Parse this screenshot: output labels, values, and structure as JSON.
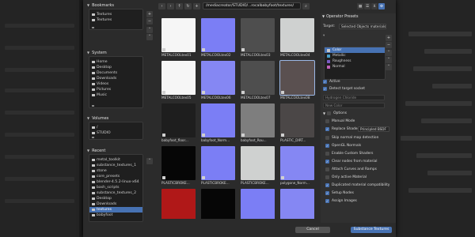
{
  "sidebar": {
    "bookmarks": {
      "title": "Bookmarks",
      "items": [
        "Textures",
        "Textures"
      ]
    },
    "system": {
      "title": "System",
      "items": [
        "Home",
        "Desktop",
        "Documents",
        "Downloads",
        "Videos",
        "Pictures",
        "Music"
      ]
    },
    "volumes": {
      "title": "Volumes",
      "items": [
        "/",
        "STUDIO"
      ]
    },
    "recent": {
      "title": "Recent",
      "items": [
        "metal_toolkit",
        "substance_textures_1",
        "stone",
        "core_presets",
        "blender-4.5.2-linux-x64",
        "bash_scripts",
        "substance_textures_2",
        "Desktop",
        "Downloads",
        "textures",
        "babyfoot"
      ]
    }
  },
  "topbar": {
    "path": "/mediacreator/STUDIO/...rocalbabyfoot/textures/"
  },
  "grid": {
    "tiles": [
      {
        "label": "METALCOOLtex01"
      },
      {
        "label": "METALCOOLtex02"
      },
      {
        "label": "METALCOOLtex03"
      },
      {
        "label": "METALCOOLtex04"
      },
      {
        "label": "METALCOOLtex05"
      },
      {
        "label": "METALCOOLtex06"
      },
      {
        "label": "METALCOOLtex07"
      },
      {
        "label": "METALCOOLtex08"
      },
      {
        "label": "babyfoot_floor..."
      },
      {
        "label": "babyfoot_Norm..."
      },
      {
        "label": "babyfoot_Rou..."
      },
      {
        "label": "PLASTIC_DIRT..."
      },
      {
        "label": "PLASTICBROKE..."
      },
      {
        "label": "PLASTICBROKE..."
      },
      {
        "label": "PLASTICBROKE..."
      },
      {
        "label": "polygone_Norm..."
      },
      {
        "label": "PLASTICBROKE..."
      },
      {
        "label": "PLASTICBROKE..."
      },
      {
        "label": "PLASTICBROKE..."
      },
      {
        "label": "PLASTICBROKE..."
      }
    ]
  },
  "operator": {
    "presets_label": "Operator Presets",
    "target_label": "Target:",
    "target_value": "Selected Objects materials",
    "layers": [
      {
        "name": "Color",
        "color": "#c9c9c9"
      },
      {
        "name": "Metallic",
        "color": "#49a0c9"
      },
      {
        "name": "Roughness",
        "color": "#7a5cc6"
      },
      {
        "name": "Normal",
        "color": "#c063b8"
      }
    ],
    "active_label": "Active",
    "detect_label": "Detect target socket",
    "input_placeholder": "Hydrogen Chloride",
    "input2_placeholder": "New Color",
    "options_label": "Options",
    "manual_mode": "Manual Mode",
    "replace_shader_label": "Replace Shader",
    "replace_shader_value": "Principled BSDF",
    "options": [
      {
        "label": "Skip normal map detection",
        "on": false
      },
      {
        "label": "OpenGL Normals",
        "on": true
      },
      {
        "label": "Enable Custom Shaders",
        "on": false
      },
      {
        "label": "Clear nodes from material",
        "on": true
      },
      {
        "label": "Attach Curves and Ramps",
        "on": false
      },
      {
        "label": "Only active Material",
        "on": false
      },
      {
        "label": "Duplicated material compatibility",
        "on": true
      },
      {
        "label": "Setup Nodes",
        "on": true
      },
      {
        "label": "Assign Images",
        "on": true
      }
    ]
  },
  "footer": {
    "cancel": "Cancel",
    "confirm": "Substance Textures"
  }
}
